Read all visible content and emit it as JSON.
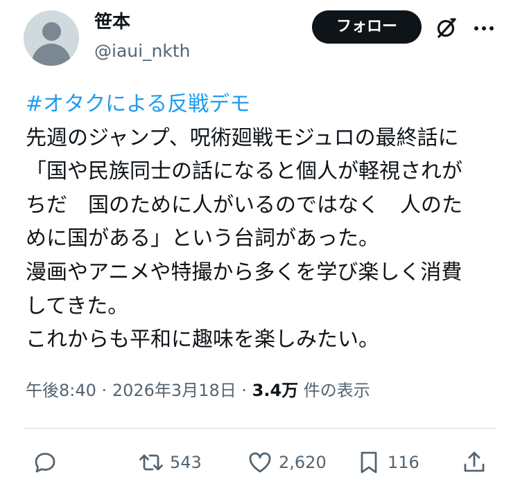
{
  "author": {
    "display_name": "笹本",
    "handle": "@iaui_nkth"
  },
  "header": {
    "follow_label": "フォロー",
    "grok_icon": "grok-icon",
    "more_icon": "more-horizontal-icon"
  },
  "tweet": {
    "hashtag": "#オタクによる反戦デモ",
    "lines": [
      "先週のジャンプ、呪術廻戦モジュロの最終話に",
      "「国や民族同士の話になると個人が軽視されが",
      "ちだ　国のために人がいるのではなく　人のた",
      "めに国がある」という台詞があった。",
      "漫画やアニメや特撮から多くを学び楽しく消費",
      "してきた。",
      "これからも平和に趣味を楽しみたい。"
    ]
  },
  "meta": {
    "time": "午後8:40",
    "separator": "·",
    "date": "2026年3月18日",
    "views_count": "3.4万",
    "views_label": "件の表示"
  },
  "actions": {
    "reply": {
      "icon": "reply-icon",
      "count": ""
    },
    "retweet": {
      "icon": "retweet-icon",
      "count": "543"
    },
    "like": {
      "icon": "heart-icon",
      "count": "2,620"
    },
    "bookmark": {
      "icon": "bookmark-icon",
      "count": "116"
    },
    "share": {
      "icon": "share-icon",
      "count": ""
    }
  },
  "colors": {
    "text": "#0f1419",
    "secondary": "#536471",
    "link": "#1d9bf0",
    "button_bg": "#0f1419",
    "divider": "#cfd9de"
  }
}
